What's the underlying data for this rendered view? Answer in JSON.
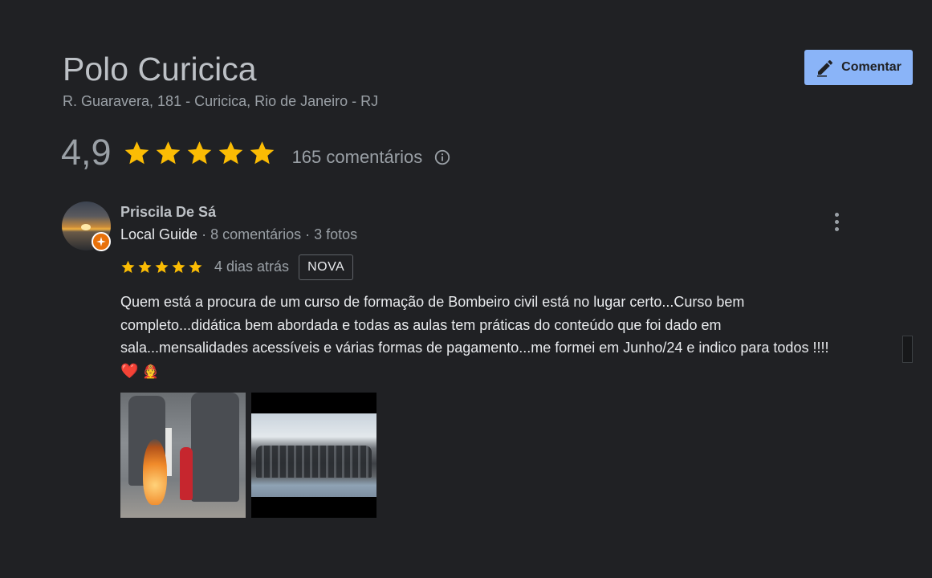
{
  "place": {
    "name": "Polo Curicica",
    "address": "R. Guaravera, 181 - Curicica, Rio de Janeiro - RJ"
  },
  "actions": {
    "comment_label": "Comentar",
    "comment_icon": "edit-pencil-icon"
  },
  "summary": {
    "rating": "4,9",
    "stars": 5,
    "review_count": "165 comentários",
    "info_icon": "info-icon"
  },
  "review": {
    "author": "Priscila De Sá",
    "local_guide": "Local Guide",
    "meta_sep1": " · ",
    "comment_count": "8 comentários",
    "meta_sep2": " · ",
    "photo_count": "3 fotos",
    "stars": 5,
    "date": "4 dias atrás",
    "badge": "NOVA",
    "text": "Quem está a procura de um curso de formação de Bombeiro civil está no lugar certo...Curso bem completo...didática bem abordada e todas as aulas tem práticas do conteúdo que foi dado em sala...mensalidades acessíveis e várias formas de pagamento...me formei em Junho/24 e indico para todos !!!! ",
    "emoji_heart": "❤️",
    "emoji_firefighter": "🧑‍🚒",
    "photos": [
      "firefighter-training-photo",
      "group-photo"
    ]
  },
  "colors": {
    "background": "#202124",
    "accent_button": "#8ab4f8",
    "star": "#fbbc04",
    "title_text": "#bdc1c6",
    "secondary_text": "#9aa0a6",
    "body_text": "#e8eaed",
    "local_guide_badge": "#e8710a"
  }
}
